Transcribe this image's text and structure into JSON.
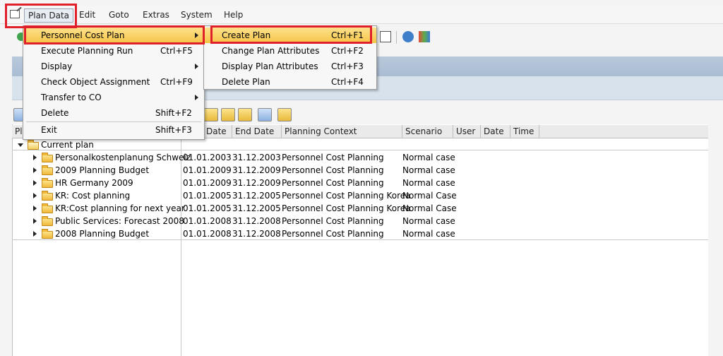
{
  "menubar": {
    "items": [
      {
        "label": "Plan Data"
      },
      {
        "label": "Edit"
      },
      {
        "label": "Goto"
      },
      {
        "label": "Extras"
      },
      {
        "label": "System"
      },
      {
        "label": "Help"
      }
    ]
  },
  "plan_menu": {
    "items": [
      {
        "label": "Personnel Cost Plan",
        "shortcut": "",
        "submenu": true
      },
      {
        "label": "Execute Planning Run",
        "shortcut": "Ctrl+F5"
      },
      {
        "label": "Display",
        "shortcut": "",
        "submenu": true
      },
      {
        "label": "Check Object Assignment",
        "shortcut": "Ctrl+F9"
      },
      {
        "label": "Transfer to CO",
        "shortcut": "",
        "submenu": true
      },
      {
        "label": "Delete",
        "shortcut": "Shift+F2"
      },
      {
        "label": "Exit",
        "shortcut": "Shift+F3"
      }
    ]
  },
  "submenu": {
    "items": [
      {
        "label": "Create Plan",
        "shortcut": "Ctrl+F1"
      },
      {
        "label": "Change Plan Attributes",
        "shortcut": "Ctrl+F2"
      },
      {
        "label": "Display Plan Attributes",
        "shortcut": "Ctrl+F3"
      },
      {
        "label": "Delete Plan",
        "shortcut": "Ctrl+F4"
      }
    ]
  },
  "columns": {
    "pl": "Pl",
    "start_date": "Date",
    "end_date": "End Date",
    "context": "Planning Context",
    "scenario": "Scenario",
    "user": "User",
    "date": "Date",
    "time": "Time"
  },
  "tree": {
    "root": "Current plan",
    "rows": [
      {
        "name": "Personalkostenplanung Schweiz",
        "start": "01.01.2003",
        "end": "31.12.2003",
        "context": "Personnel Cost Planning",
        "scenario": "Normal case"
      },
      {
        "name": "2009 Planning Budget",
        "start": "01.01.2009",
        "end": "31.12.2009",
        "context": "Personnel Cost Planning",
        "scenario": "Normal case"
      },
      {
        "name": "HR Germany 2009",
        "start": "01.01.2009",
        "end": "31.12.2009",
        "context": "Personnel Cost Planning",
        "scenario": "Normal case"
      },
      {
        "name": "KR: Cost planning",
        "start": "01.01.2005",
        "end": "31.12.2005",
        "context": "Personnel Cost Planning Korea",
        "scenario": "Normal Case"
      },
      {
        "name": "KR:Cost planning for next year",
        "start": "01.01.2005",
        "end": "31.12.2005",
        "context": "Personnel Cost Planning Korea",
        "scenario": "Normal Case"
      },
      {
        "name": "Public Services: Forecast 2008",
        "start": "01.01.2008",
        "end": "31.12.2008",
        "context": "Personnel Cost Planning",
        "scenario": "Normal case"
      },
      {
        "name": "2008 Planning Budget",
        "start": "01.01.2008",
        "end": "31.12.2008",
        "context": "Personnel Cost Planning",
        "scenario": "Normal case"
      }
    ]
  },
  "colors": {
    "highlight": "#f6c548",
    "annotation_red": "#e0202a"
  }
}
